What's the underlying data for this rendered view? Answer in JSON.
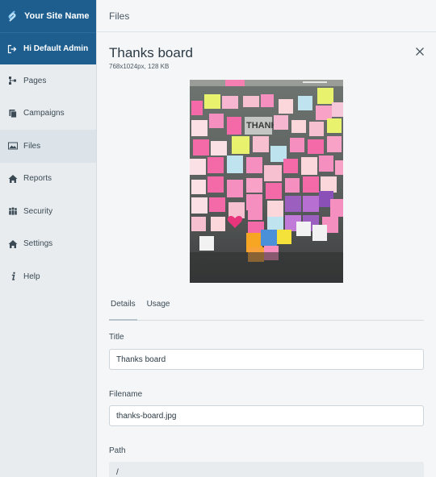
{
  "sidebar": {
    "site_name": "Your Site Name",
    "user_greeting": "Hi Default Admin",
    "items": [
      {
        "label": "Pages",
        "icon": "sitemap-icon"
      },
      {
        "label": "Campaigns",
        "icon": "copy-icon"
      },
      {
        "label": "Files",
        "icon": "image-icon",
        "active": true
      },
      {
        "label": "Reports",
        "icon": "home-icon"
      },
      {
        "label": "Security",
        "icon": "users-icon"
      },
      {
        "label": "Settings",
        "icon": "home-icon"
      },
      {
        "label": "Help",
        "icon": "info-icon"
      }
    ]
  },
  "topbar": {
    "title": "Files"
  },
  "file": {
    "title": "Thanks board",
    "dimensions": "768x1024px, 128 KB"
  },
  "tabs": [
    {
      "label": "Details",
      "active": true
    },
    {
      "label": "Usage",
      "active": false
    }
  ],
  "form": {
    "title_label": "Title",
    "title_value": "Thanks board",
    "filename_label": "Filename",
    "filename_value": "thanks-board.jpg",
    "path_label": "Path",
    "path_value": "/"
  },
  "colors": {
    "brand": "#1d5e8f",
    "sidebar_bg": "#e8ecef",
    "active_item": "#dce4ea"
  }
}
